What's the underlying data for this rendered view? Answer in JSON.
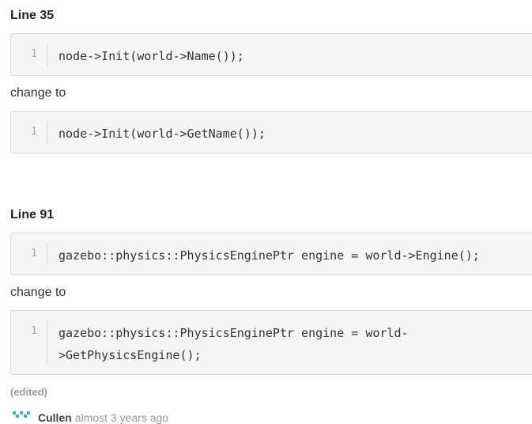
{
  "sections": [
    {
      "heading": "Line 35",
      "original": {
        "line_no": "1",
        "code": "node->Init(world->Name());"
      },
      "change_label": "change to",
      "replacement": {
        "line_no": "1",
        "code": "node->Init(world->GetName());"
      }
    },
    {
      "heading": "Line 91",
      "original": {
        "line_no": "1",
        "code": "gazebo::physics::PhysicsEnginePtr engine = world->Engine();"
      },
      "change_label": "change to",
      "replacement": {
        "line_no": "1",
        "code": "gazebo::physics::PhysicsEnginePtr engine = world-\n>GetPhysicsEngine();"
      }
    }
  ],
  "edited_label": "(edited)",
  "next_comment": {
    "author": "Cullen",
    "time": "almost 3 years ago",
    "avatar_icon": "identicon-icon",
    "avatar_color": "#2fbfa9"
  }
}
